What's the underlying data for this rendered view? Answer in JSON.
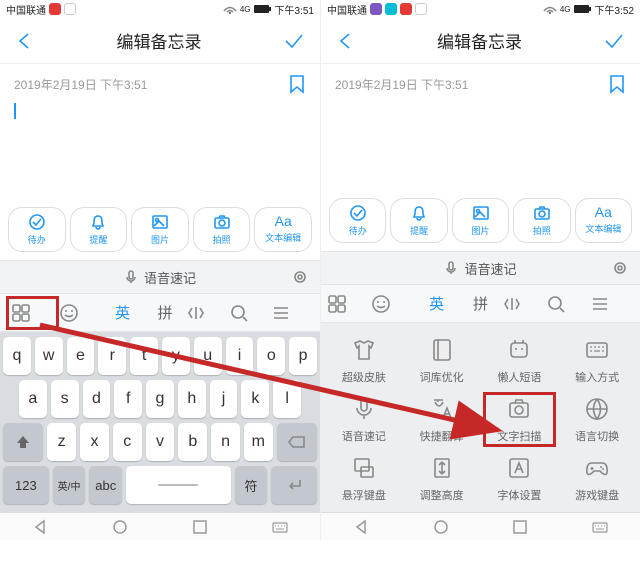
{
  "left": {
    "status": {
      "carrier": "中国联通",
      "time": "下午3:51"
    },
    "header": {
      "title": "编辑备忘录"
    },
    "timestamp": "2019年2月19日 下午3:51",
    "toolbar": [
      {
        "label": "待办"
      },
      {
        "label": "提醒"
      },
      {
        "label": "图片"
      },
      {
        "label": "拍照"
      },
      {
        "label": "文本编辑"
      }
    ],
    "voice": "语音速记",
    "kbtabs": {
      "lang": "英",
      "mode": "拼"
    },
    "keys": {
      "r1": [
        "q",
        "w",
        "e",
        "r",
        "t",
        "y",
        "u",
        "i",
        "o",
        "p"
      ],
      "r2": [
        "a",
        "s",
        "d",
        "f",
        "g",
        "h",
        "j",
        "k",
        "l"
      ],
      "r3": [
        "z",
        "x",
        "c",
        "v",
        "b",
        "n",
        "m"
      ],
      "num": "123",
      "lang2": "英/中",
      "abc": "abc",
      "sym": "符"
    }
  },
  "right": {
    "status": {
      "carrier": "中国联通",
      "time": "下午3:52"
    },
    "header": {
      "title": "编辑备忘录"
    },
    "timestamp": "2019年2月19日 下午3:51",
    "toolbar": [
      {
        "label": "待办"
      },
      {
        "label": "提醒"
      },
      {
        "label": "图片"
      },
      {
        "label": "拍照"
      },
      {
        "label": "文本编辑"
      }
    ],
    "voice": "语音速记",
    "kbtabs": {
      "lang": "英",
      "mode": "拼"
    },
    "grid": [
      {
        "label": "超级皮肤"
      },
      {
        "label": "词库优化"
      },
      {
        "label": "懒人短语"
      },
      {
        "label": "输入方式"
      },
      {
        "label": "语音速记"
      },
      {
        "label": "快捷翻译"
      },
      {
        "label": "文字扫描"
      },
      {
        "label": "语言切换"
      },
      {
        "label": "悬浮键盘"
      },
      {
        "label": "调整高度"
      },
      {
        "label": "字体设置"
      },
      {
        "label": "游戏键盘"
      }
    ]
  }
}
